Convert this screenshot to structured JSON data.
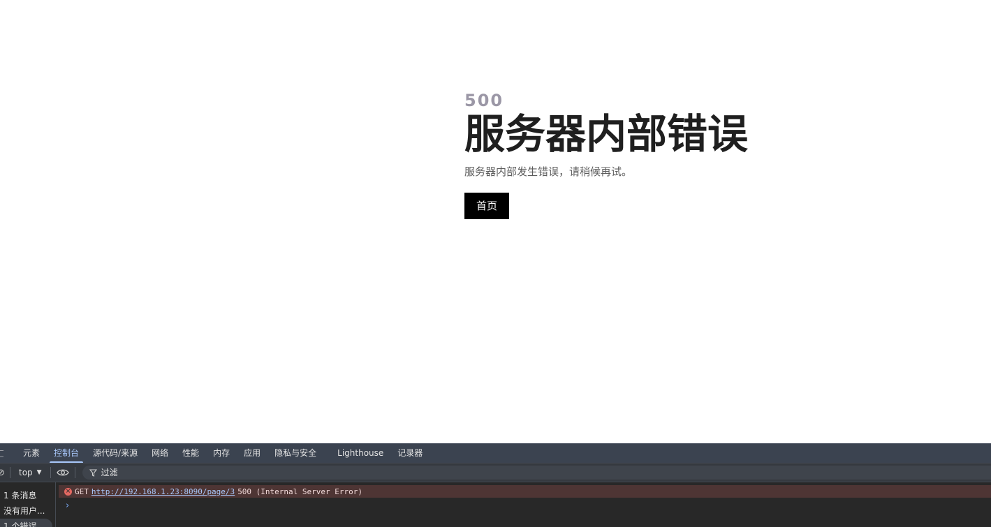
{
  "page": {
    "error_code": "500",
    "title": "服务器内部错误",
    "description": "服务器内部发生错误，请稍候再试。",
    "home_button": "首页"
  },
  "devtools": {
    "tabs": [
      {
        "label": "元素",
        "active": false
      },
      {
        "label": "控制台",
        "active": true
      },
      {
        "label": "源代码/来源",
        "active": false
      },
      {
        "label": "网络",
        "active": false
      },
      {
        "label": "性能",
        "active": false
      },
      {
        "label": "内存",
        "active": false
      },
      {
        "label": "应用",
        "active": false
      },
      {
        "label": "隐私与安全",
        "active": false
      },
      {
        "label": "Lighthouse",
        "active": false
      },
      {
        "label": "记录器",
        "active": false
      }
    ],
    "toolbar": {
      "context": "top",
      "filter_placeholder": "过滤"
    },
    "sidebar": {
      "items": [
        "1 条消息",
        "没有用户...",
        "1 个错误"
      ]
    },
    "console": {
      "error": {
        "method": "GET",
        "url": "http://192.168.1.23:8090/page/3",
        "status": "500 (Internal Server Error)"
      }
    },
    "colors": {
      "active_tab": "#a8c7fa",
      "error_bg": "#4e3534",
      "error_icon": "#e46962"
    }
  }
}
